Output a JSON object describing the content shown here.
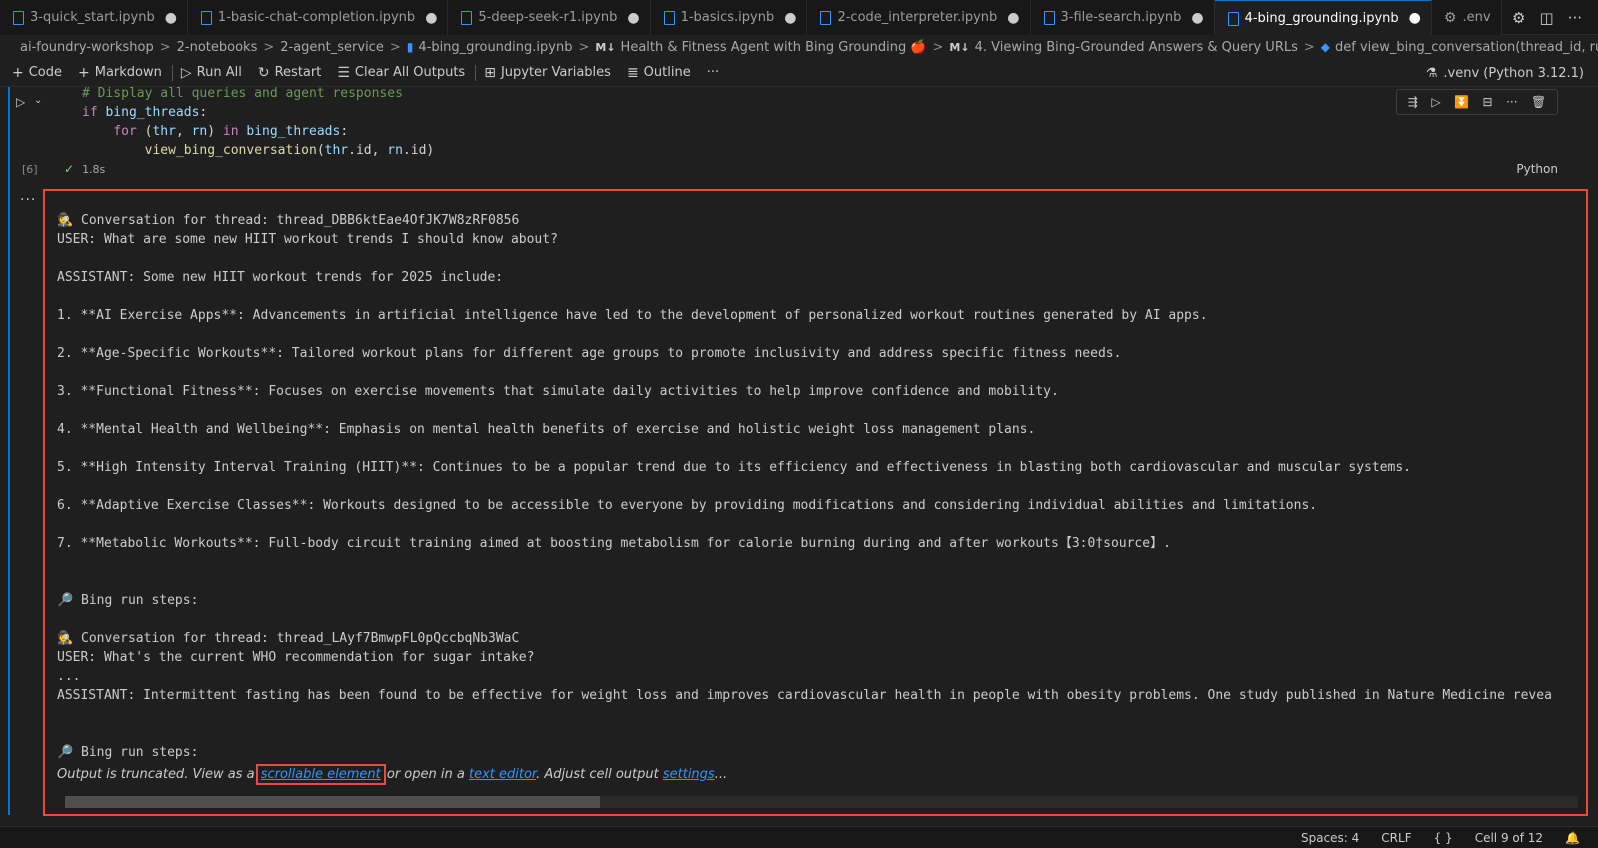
{
  "tabs": [
    {
      "label": "3-quick_start.ipynb",
      "modified": true
    },
    {
      "label": "1-basic-chat-completion.ipynb",
      "modified": true
    },
    {
      "label": "5-deep-seek-r1.ipynb",
      "modified": true
    },
    {
      "label": "1-basics.ipynb",
      "modified": true
    },
    {
      "label": "2-code_interpreter.ipynb",
      "modified": true
    },
    {
      "label": "3-file-search.ipynb",
      "modified": true
    },
    {
      "label": "4-bing_grounding.ipynb",
      "modified": true,
      "active": true
    },
    {
      "label": ".env",
      "modified": false
    }
  ],
  "tab_dot": "●",
  "breadcrumb": [
    "ai-foundry-workshop",
    "2-notebooks",
    "2-agent_service",
    "4-bing_grounding.ipynb",
    "Health & Fitness Agent with Bing Grounding 🍎",
    "4. Viewing Bing-Grounded Answers & Query URLs",
    "def view_bing_conversation(thread_id, run_id):"
  ],
  "toolbar": {
    "code": "Code",
    "markdown": "Markdown",
    "run_all": "Run All",
    "restart": "Restart",
    "clear_outputs": "Clear All Outputs",
    "variables": "Jupyter Variables",
    "outline": "Outline",
    "more": "···",
    "kernel": ".venv (Python 3.12.1)"
  },
  "code_lines": {
    "l1": "# Display all queries and agent responses",
    "l2_kw": "if",
    "l2_var": "bing_threads",
    "l3_kw": "for",
    "l3_a": "thr",
    "l3_b": "rn",
    "l3_in": "in",
    "l3_var": "bing_threads",
    "l4_fn": "view_bing_conversation",
    "l4_a": "thr",
    "l4_b": "rn"
  },
  "exec": {
    "count": "[6]",
    "time": "1.8s",
    "language": "Python"
  },
  "output_lines": [
    "🕵 Conversation for thread: thread_DBB6ktEae4OfJK7W8zRF0856",
    "USER: What are some new HIIT workout trends I should know about?",
    "",
    "ASSISTANT: Some new HIIT workout trends for 2025 include:",
    "",
    "1. **AI Exercise Apps**: Advancements in artificial intelligence have led to the development of personalized workout routines generated by AI apps.",
    "",
    "2. **Age-Specific Workouts**: Tailored workout plans for different age groups to promote inclusivity and address specific fitness needs.",
    "",
    "3. **Functional Fitness**: Focuses on exercise movements that simulate daily activities to help improve confidence and mobility.",
    "",
    "4. **Mental Health and Wellbeing**: Emphasis on mental health benefits of exercise and holistic weight loss management plans.",
    "",
    "5. **High Intensity Interval Training (HIIT)**: Continues to be a popular trend due to its efficiency and effectiveness in blasting both cardiovascular and muscular systems.",
    "",
    "6. **Adaptive Exercise Classes**: Workouts designed to be accessible to everyone by providing modifications and considering individual abilities and limitations.",
    "",
    "7. **Metabolic Workouts**: Full-body circuit training aimed at boosting metabolism for calorie burning during and after workouts【3:0†source】.",
    "",
    "",
    "🔎 Bing run steps:",
    "",
    "🕵 Conversation for thread: thread_LAyf7BmwpFL0pQccbqNb3WaC",
    "USER: What's the current WHO recommendation for sugar intake?",
    "...",
    "ASSISTANT: Intermittent fasting has been found to be effective for weight loss and improves cardiovascular health in people with obesity problems. One study published in Nature Medicine revea",
    "",
    "",
    "🔎 Bing run steps:"
  ],
  "truncation": {
    "prefix": "Output is truncated. View as a",
    "link_scrollable": "scrollable element",
    "middle": "or open in a",
    "link_editor": "text editor",
    "suffix": ". Adjust cell output",
    "link_settings": "settings",
    "ellipsis": "..."
  },
  "statusbar": {
    "spaces": "Spaces: 4",
    "eol": "CRLF",
    "braces": "{ }",
    "cell": "Cell 9 of 12"
  }
}
